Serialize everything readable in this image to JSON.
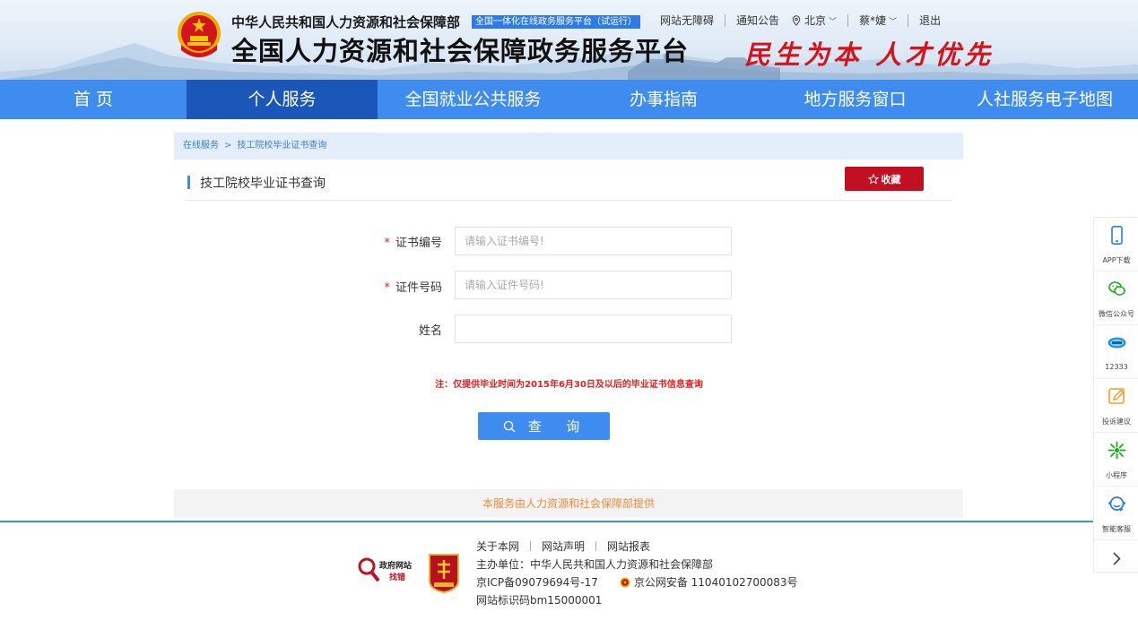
{
  "header": {
    "site_subtitle": "中华人民共和国人力资源和社会保障部",
    "beta_badge": "全国一体化在线政务服务平台（试运行）",
    "site_title": "全国人力资源和社会保障政务服务平台",
    "slogan": "民生为本 人才优先",
    "links": {
      "accessibility": "网站无障碍",
      "notice": "通知公告",
      "location": "北京",
      "user": "蔡*婕",
      "logout": "退出"
    }
  },
  "nav": {
    "items": [
      {
        "label": "首 页"
      },
      {
        "label": "个人服务"
      },
      {
        "label": "全国就业公共服务"
      },
      {
        "label": "办事指南"
      },
      {
        "label": "地方服务窗口"
      },
      {
        "label": "人社服务电子地图"
      }
    ],
    "active_index": 1
  },
  "breadcrumb": {
    "items": [
      "在线服务",
      "技工院校毕业证书查询"
    ],
    "separator": ">"
  },
  "page": {
    "title": "技工院校毕业证书查询",
    "favorite_label": "收藏"
  },
  "form": {
    "fields": [
      {
        "label": "证书编号",
        "required": true,
        "placeholder": "请输入证书编号!",
        "value": ""
      },
      {
        "label": "证件号码",
        "required": true,
        "placeholder": "请输入证件号码!",
        "value": ""
      },
      {
        "label": "姓名",
        "required": false,
        "placeholder": "",
        "value": ""
      }
    ],
    "required_mark": "*",
    "note": "注：仅提供毕业时间为2015年6月30日及以后的毕业证书信息查询",
    "submit_label": "查  询"
  },
  "provider": "本服务由人力资源和社会保障部提供",
  "footer": {
    "links": [
      "关于本网",
      "网站声明",
      "网站报表"
    ],
    "host": "主办单位：中华人民共和国人力资源和社会保障部",
    "icp": "京ICP备09079694号-17",
    "police": "京公网安备 11040102700083号",
    "site_code": "网站标识码bm15000001",
    "gov_logo_line1": "政府网站",
    "gov_logo_line2": "找错"
  },
  "sidebar": {
    "items": [
      {
        "label": "APP下载",
        "icon": "phone-icon"
      },
      {
        "label": "微信公众号",
        "icon": "wechat-icon"
      },
      {
        "label": "12333",
        "icon": "hotline-12333-icon"
      },
      {
        "label": "投诉建议",
        "icon": "edit-icon"
      },
      {
        "label": "小程序",
        "icon": "mini-program-icon"
      },
      {
        "label": "智能客服",
        "icon": "customer-service-icon"
      }
    ]
  },
  "colors": {
    "primary": "#3e8cf0",
    "nav_active": "#1a57b8",
    "danger": "#c20f22",
    "note_red": "#e02020",
    "provider_orange": "#f08a3c"
  }
}
